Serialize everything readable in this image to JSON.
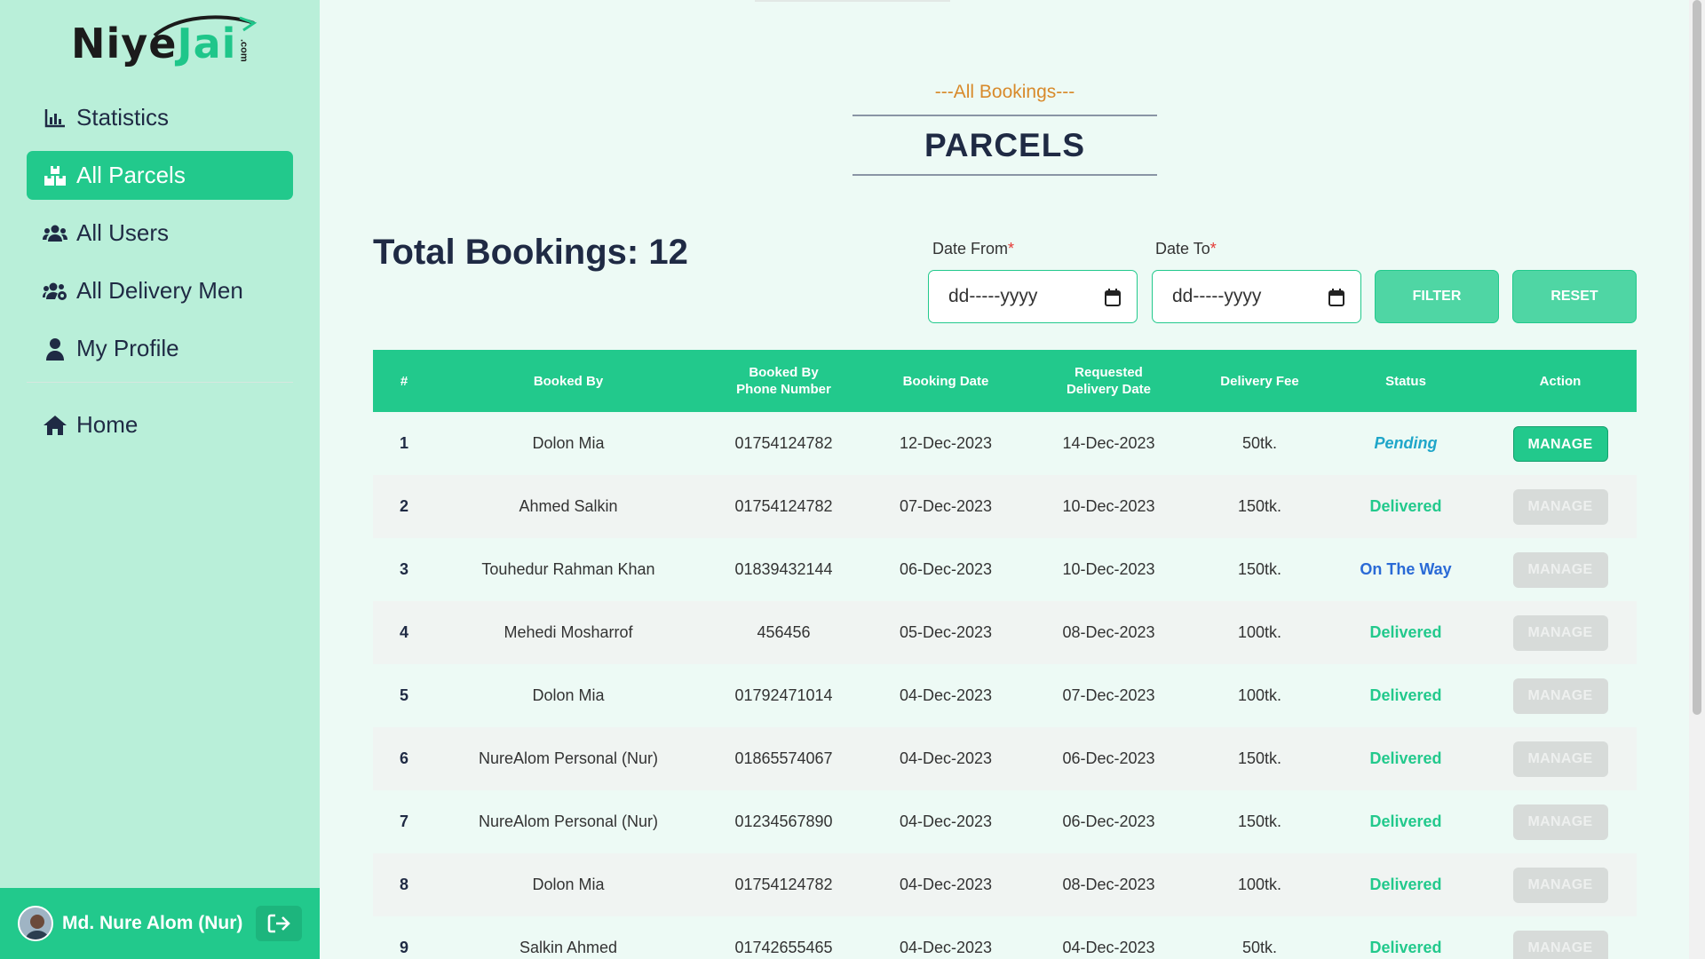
{
  "brand": {
    "logo_text_a": "Niye",
    "logo_text_b": "Jai",
    "logo_suffix": ".com"
  },
  "sidebar": {
    "items": [
      {
        "label": "Statistics",
        "icon": "chart-bar-icon"
      },
      {
        "label": "All Parcels",
        "icon": "boxes-icon",
        "active": true
      },
      {
        "label": "All Users",
        "icon": "users-icon"
      },
      {
        "label": "All Delivery Men",
        "icon": "users-gear-icon"
      },
      {
        "label": "My Profile",
        "icon": "user-icon"
      }
    ],
    "home": {
      "label": "Home",
      "icon": "home-icon"
    }
  },
  "user": {
    "name": "Md. Nure Alom (Nur)"
  },
  "header": {
    "subtitle": "---All Bookings---",
    "title": "PARCELS"
  },
  "summary": {
    "total_label": "Total Bookings: 12"
  },
  "filter": {
    "date_from_label": "Date From",
    "date_to_label": "Date To",
    "required_mark": "*",
    "date_from_value": "dd-----yyyy",
    "date_to_value": "dd-----yyyy",
    "filter_label": "FILTER",
    "reset_label": "RESET"
  },
  "table": {
    "headers": [
      "#",
      "Booked By",
      "Booked By Phone Number",
      "Booking Date",
      "Requested Delivery Date",
      "Delivery Fee",
      "Status",
      "Action"
    ],
    "rows": [
      {
        "n": "1",
        "by": "Dolon Mia",
        "phone": "01754124782",
        "bdate": "12-Dec-2023",
        "rdate": "14-Dec-2023",
        "fee": "50tk.",
        "status": "Pending",
        "action": "MANAGE"
      },
      {
        "n": "2",
        "by": "Ahmed Salkin",
        "phone": "01754124782",
        "bdate": "07-Dec-2023",
        "rdate": "10-Dec-2023",
        "fee": "150tk.",
        "status": "Delivered",
        "action": "MANAGE"
      },
      {
        "n": "3",
        "by": "Touhedur Rahman Khan",
        "phone": "01839432144",
        "bdate": "06-Dec-2023",
        "rdate": "10-Dec-2023",
        "fee": "150tk.",
        "status": "On The Way",
        "action": "MANAGE"
      },
      {
        "n": "4",
        "by": "Mehedi Mosharrof",
        "phone": "456456",
        "bdate": "05-Dec-2023",
        "rdate": "08-Dec-2023",
        "fee": "100tk.",
        "status": "Delivered",
        "action": "MANAGE"
      },
      {
        "n": "5",
        "by": "Dolon Mia",
        "phone": "01792471014",
        "bdate": "04-Dec-2023",
        "rdate": "07-Dec-2023",
        "fee": "100tk.",
        "status": "Delivered",
        "action": "MANAGE"
      },
      {
        "n": "6",
        "by": "NureAlom Personal (Nur)",
        "phone": "01865574067",
        "bdate": "04-Dec-2023",
        "rdate": "06-Dec-2023",
        "fee": "150tk.",
        "status": "Delivered",
        "action": "MANAGE"
      },
      {
        "n": "7",
        "by": "NureAlom Personal (Nur)",
        "phone": "01234567890",
        "bdate": "04-Dec-2023",
        "rdate": "06-Dec-2023",
        "fee": "150tk.",
        "status": "Delivered",
        "action": "MANAGE"
      },
      {
        "n": "8",
        "by": "Dolon Mia",
        "phone": "01754124782",
        "bdate": "04-Dec-2023",
        "rdate": "08-Dec-2023",
        "fee": "100tk.",
        "status": "Delivered",
        "action": "MANAGE"
      },
      {
        "n": "9",
        "by": "Salkin Ahmed",
        "phone": "01742655465",
        "bdate": "04-Dec-2023",
        "rdate": "04-Dec-2023",
        "fee": "50tk.",
        "status": "Delivered",
        "action": "MANAGE"
      }
    ]
  },
  "colors": {
    "accent": "#22c98c",
    "sidebar_bg": "#b9efd9",
    "page_bg": "#edfaf5",
    "pending": "#1fa6c9",
    "on_the_way": "#2a6ad6",
    "subtitle": "#d88a2b"
  }
}
